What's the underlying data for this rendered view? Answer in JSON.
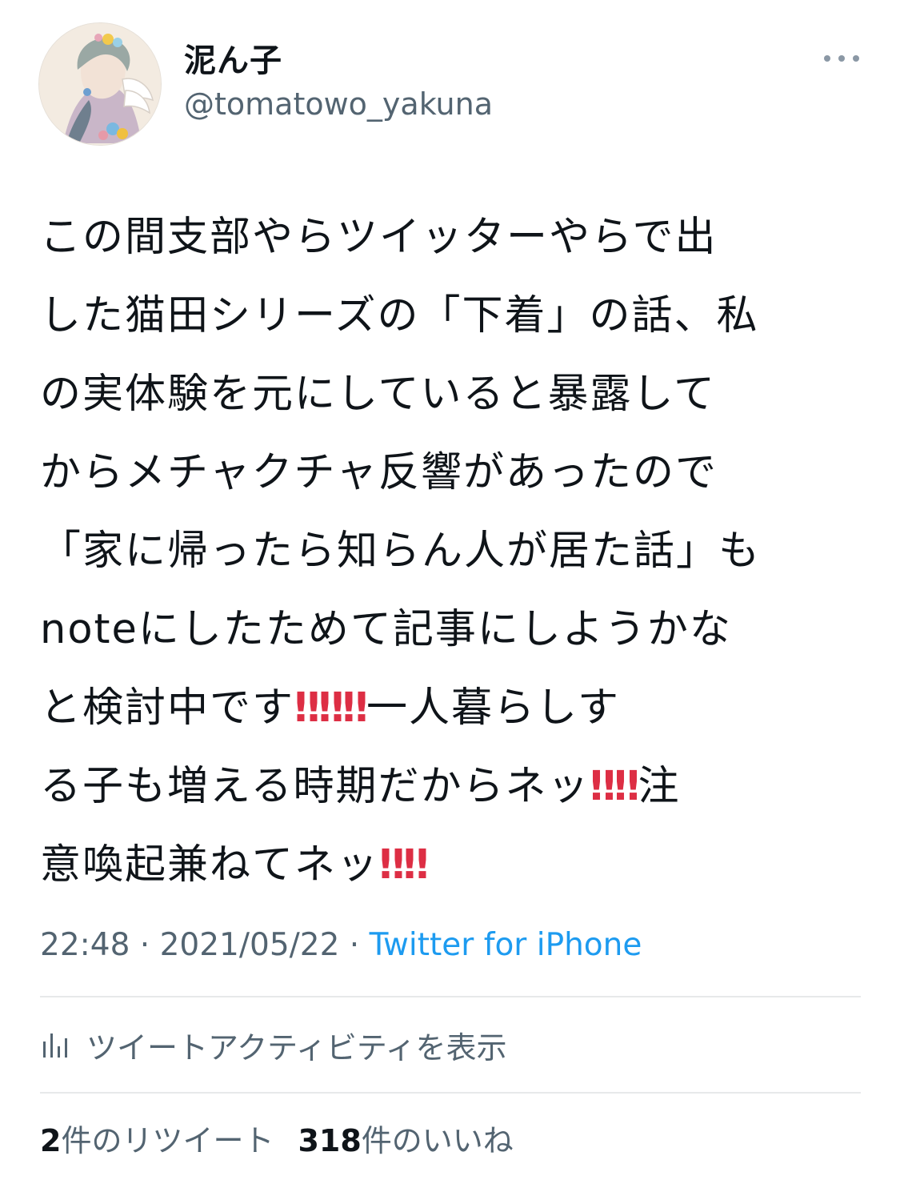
{
  "user": {
    "display_name": "泥ん子",
    "handle": "@tomatowo_yakuna",
    "avatar_icon": "illustrated-portrait-avatar"
  },
  "more_icon": "ellipsis-icon",
  "tweet": {
    "lines": [
      "この間支部やらツイッターやらで出",
      "した猫田シリーズの「下着」の話、私",
      "の実体験を元にしていると暴露して",
      "からメチャクチャ反響があったので",
      "「家に帰ったら知らん人が居た話」も",
      "noteにしたためて記事にしようかな",
      "と検討中です",
      "一人暮らしす",
      "る子も増える時期だからネッ",
      "注",
      "意喚起兼ねてネッ"
    ],
    "emoji": "‼"
  },
  "meta": {
    "time": "22:48",
    "separator": " · ",
    "date": "2021/05/22",
    "source": "Twitter for iPhone"
  },
  "activity": {
    "label": "ツイートアクティビティを表示",
    "icon": "bar-chart-icon"
  },
  "stats": {
    "retweets_count": "2",
    "retweets_label": "件のリツイート",
    "likes_count": "318",
    "likes_label": "件のいいね"
  },
  "colors": {
    "text": "#0f1419",
    "secondary": "#536471",
    "link": "#1d9bf0",
    "emoji_red": "#dd2e44",
    "divider": "#e7e9ea"
  }
}
